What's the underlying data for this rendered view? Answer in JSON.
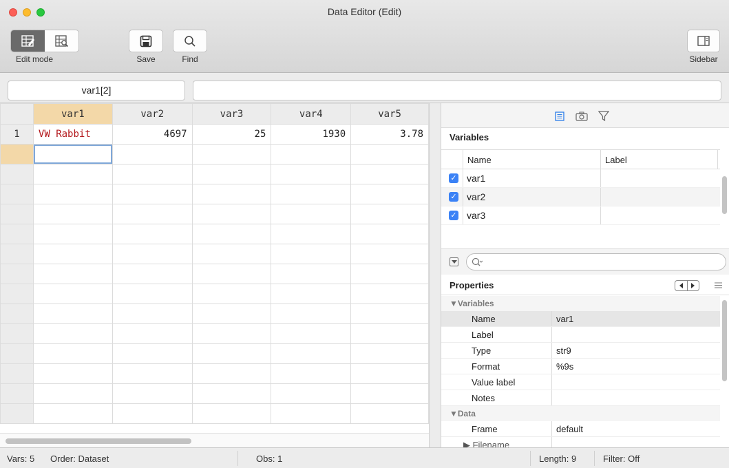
{
  "window": {
    "title": "Data Editor (Edit)"
  },
  "toolbar": {
    "edit_mode_label": "Edit mode",
    "save_label": "Save",
    "find_label": "Find",
    "sidebar_label": "Sidebar"
  },
  "varbar": {
    "current_cell": "var1[2]",
    "value": ""
  },
  "grid": {
    "columns": [
      "var1",
      "var2",
      "var3",
      "var4",
      "var5"
    ],
    "rows": [
      {
        "num": "1",
        "cells": [
          "VW Rabbit",
          "4697",
          "25",
          "1930",
          "3.78"
        ]
      }
    ]
  },
  "sidebar": {
    "variables_title": "Variables",
    "name_header": "Name",
    "label_header": "Label",
    "variables": [
      "var1",
      "var2",
      "var3"
    ],
    "properties_title": "Properties",
    "groups": {
      "variables": "▼Variables",
      "data": "▼Data"
    },
    "var_props": [
      {
        "k": "Name",
        "v": "var1"
      },
      {
        "k": "Label",
        "v": ""
      },
      {
        "k": "Type",
        "v": "str9"
      },
      {
        "k": "Format",
        "v": "%9s"
      },
      {
        "k": "Value label",
        "v": ""
      },
      {
        "k": "Notes",
        "v": ""
      }
    ],
    "data_props": [
      {
        "k": "Frame",
        "v": "default"
      },
      {
        "k": "▶ Filename",
        "v": ""
      }
    ]
  },
  "status": {
    "vars": "Vars: 5",
    "order": "Order: Dataset",
    "obs": "Obs: 1",
    "length": "Length: 9",
    "filter": "Filter: Off"
  },
  "colors": {
    "selected_header": "#f3d8a8",
    "string_text": "#b3171b",
    "checkbox": "#3b82f6"
  }
}
